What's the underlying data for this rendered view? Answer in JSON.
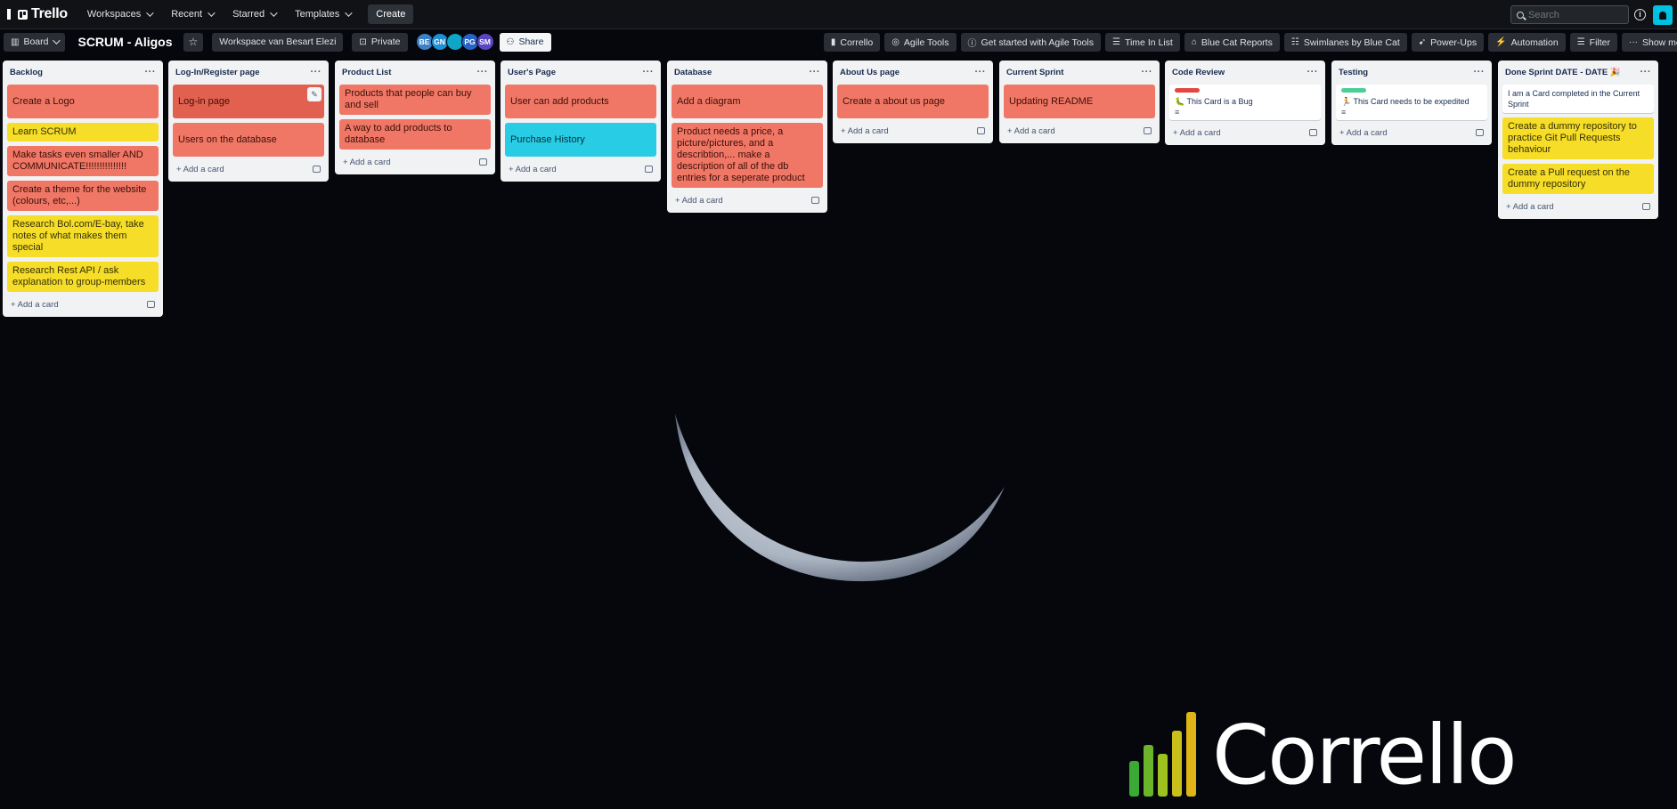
{
  "topnav": {
    "app_name": "Trello",
    "items": [
      "Workspaces",
      "Recent",
      "Starred",
      "Templates"
    ],
    "create_label": "Create",
    "search_placeholder": "Search"
  },
  "board_header": {
    "view_label": "Board",
    "title": "SCRUM - Aligos",
    "workspace_label": "Workspace van Besart Elezi",
    "visibility_label": "Private",
    "members": [
      {
        "initials": "BE",
        "color": "#3b82c4"
      },
      {
        "initials": "GN",
        "color": "#1f8fd6"
      },
      {
        "initials": "",
        "color": "#0ea5c6"
      },
      {
        "initials": "PG",
        "color": "#2563c9"
      },
      {
        "initials": "SM",
        "color": "#5b45c2"
      }
    ],
    "share_label": "Share",
    "powerups": [
      "Corrello",
      "Agile Tools",
      "Get started with Agile Tools",
      "Time In List",
      "Blue Cat Reports",
      "Swimlanes by Blue Cat",
      "Power-Ups",
      "Automation"
    ],
    "filter_label": "Filter",
    "show_menu_label": "Show menu"
  },
  "add_card_label": "Add a card",
  "lists": [
    {
      "title": "Backlog",
      "cards": [
        {
          "text": "Create a Logo",
          "color": "red"
        },
        {
          "text": "Learn SCRUM",
          "color": "yellow"
        },
        {
          "text": "Make tasks even smaller AND COMMUNICATE!!!!!!!!!!!!!!!",
          "color": "red"
        },
        {
          "text": "Create a theme for the website (colours, etc,...)",
          "color": "red"
        },
        {
          "text": "Research Bol.com/E-bay, take notes of what makes them special",
          "color": "yellow"
        },
        {
          "text": "Research Rest API / ask explanation to group-members",
          "color": "yellow"
        }
      ]
    },
    {
      "title": "Log-In/Register page",
      "cards": [
        {
          "text": "Log-in page",
          "color": "red2",
          "editing": true
        },
        {
          "text": "Users on the database",
          "color": "red"
        }
      ]
    },
    {
      "title": "Product List",
      "cards": [
        {
          "text": "Products that people can buy and sell",
          "color": "red"
        },
        {
          "text": "A way to add products to database",
          "color": "red"
        }
      ]
    },
    {
      "title": "User's Page",
      "cards": [
        {
          "text": "User can add products",
          "color": "red"
        },
        {
          "text": "Purchase History",
          "color": "cyan"
        }
      ]
    },
    {
      "title": "Database",
      "cards": [
        {
          "text": "Add a diagram",
          "color": "red"
        },
        {
          "text": "Product needs a price, a picture/pictures, and a describtion,... make a description of all of the db entries for a seperate product",
          "color": "red"
        }
      ]
    },
    {
      "title": "About Us page",
      "cards": [
        {
          "text": "Create a about us page",
          "color": "red"
        }
      ]
    },
    {
      "title": "Current Sprint",
      "cards": [
        {
          "text": "Updating README",
          "color": "red"
        }
      ]
    },
    {
      "title": "Code Review",
      "cards": [
        {
          "text": "🐛 This Card is a Bug",
          "color": "white",
          "label": "#e2483d",
          "has_desc": true
        }
      ]
    },
    {
      "title": "Testing",
      "cards": [
        {
          "text": "🏃 This Card needs to be expedited",
          "color": "white",
          "label": "#4bce97",
          "has_desc": true
        }
      ]
    },
    {
      "title": "Done Sprint DATE - DATE 🎉",
      "cards": [
        {
          "text": "I am a Card completed in the Current Sprint",
          "color": "white"
        },
        {
          "text": "Create a dummy repository to practice Git Pull Requests behaviour",
          "color": "yellow"
        },
        {
          "text": "Create a Pull request on the dummy repository",
          "color": "yellow"
        }
      ]
    }
  ],
  "background_brand": {
    "text": "Corrello",
    "bar_colors": [
      "#3aa936",
      "#6bb52a",
      "#9ec11f",
      "#c9c01a",
      "#e0b416"
    ]
  }
}
